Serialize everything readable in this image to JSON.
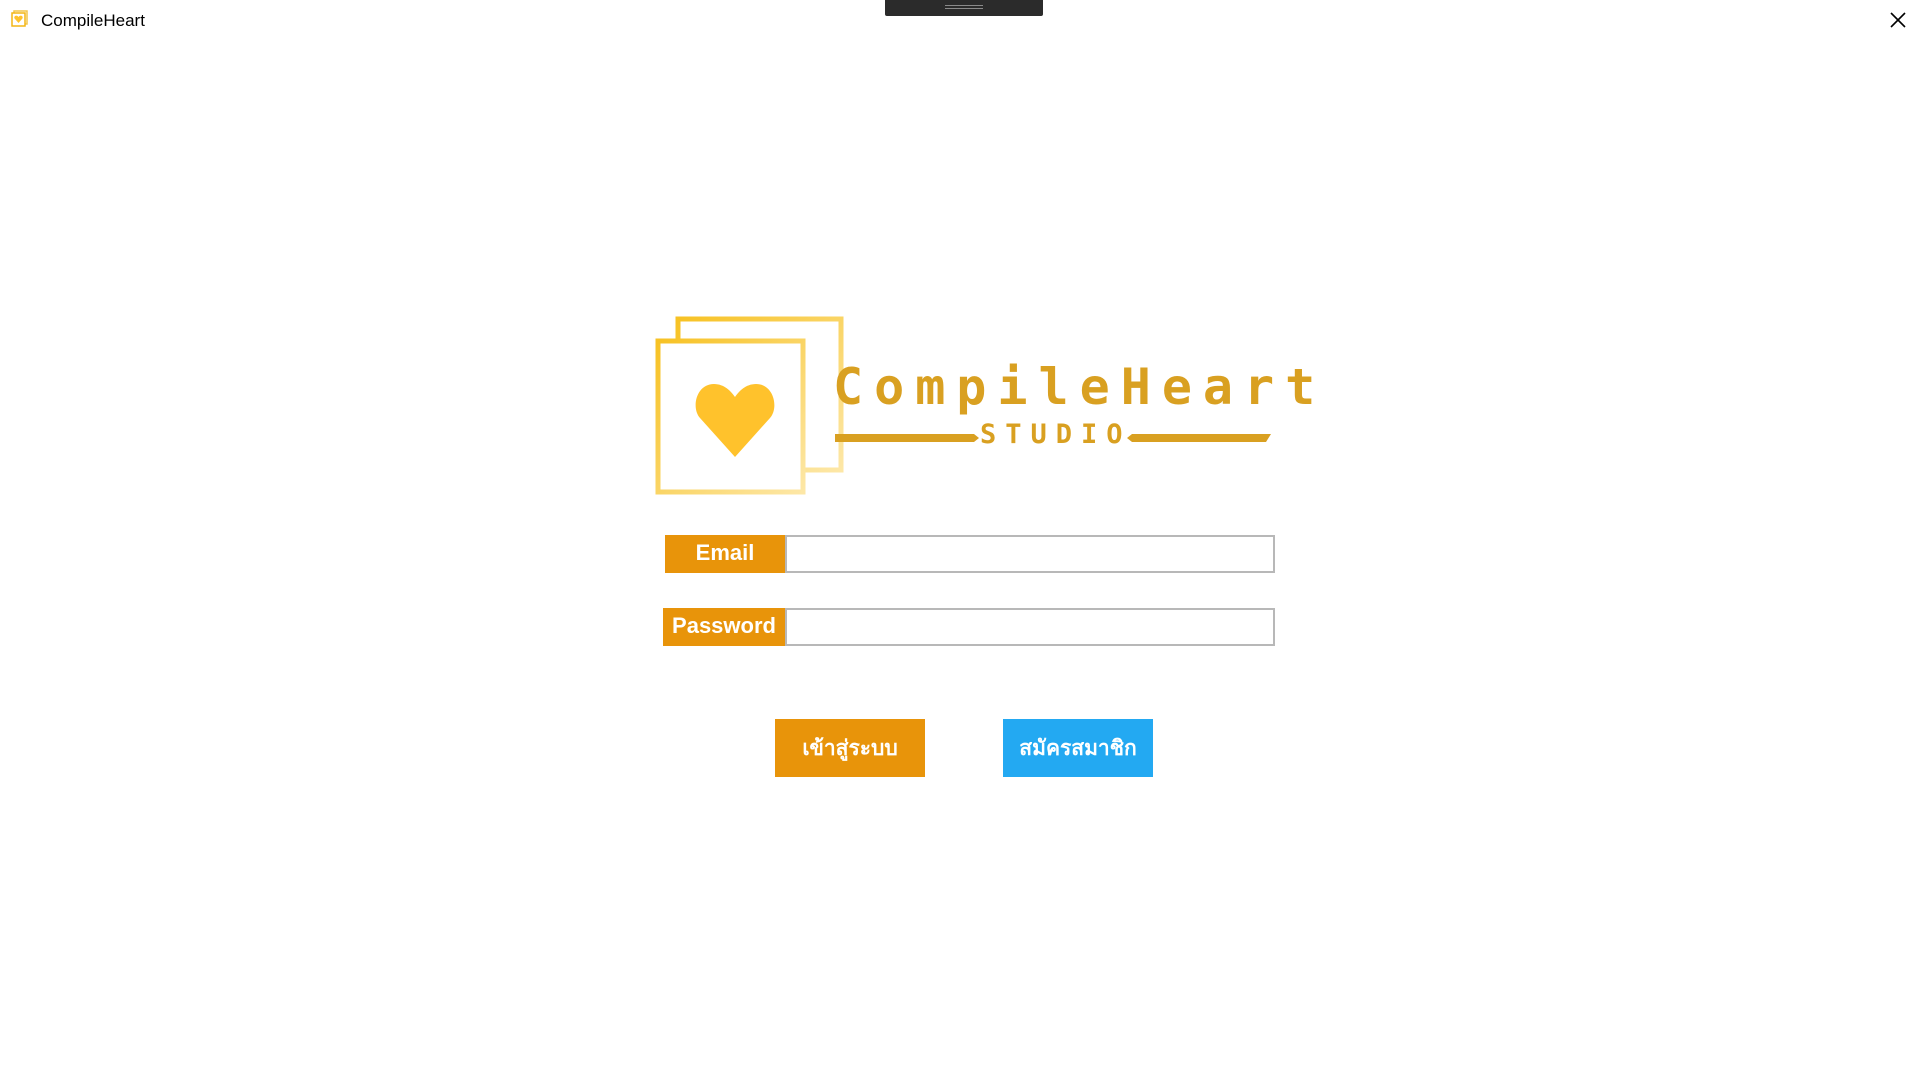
{
  "window": {
    "title": "CompileHeart",
    "icon": "app-heart-icon",
    "close_icon": "close-icon"
  },
  "logo": {
    "wordmark": "CompileHeart",
    "subtitle": "STUDIO",
    "icon": "heart-icon"
  },
  "form": {
    "email_label": "Email",
    "email_value": "",
    "password_label": "Password",
    "password_value": ""
  },
  "buttons": {
    "login_label": "เข้าสู่ระบบ",
    "register_label": "สมัครสมาชิก"
  },
  "colors": {
    "accent_orange": "#E8940A",
    "accent_blue": "#23A9F2",
    "logo_gold": "#D9A021",
    "logo_yellow": "#FFC72C"
  }
}
